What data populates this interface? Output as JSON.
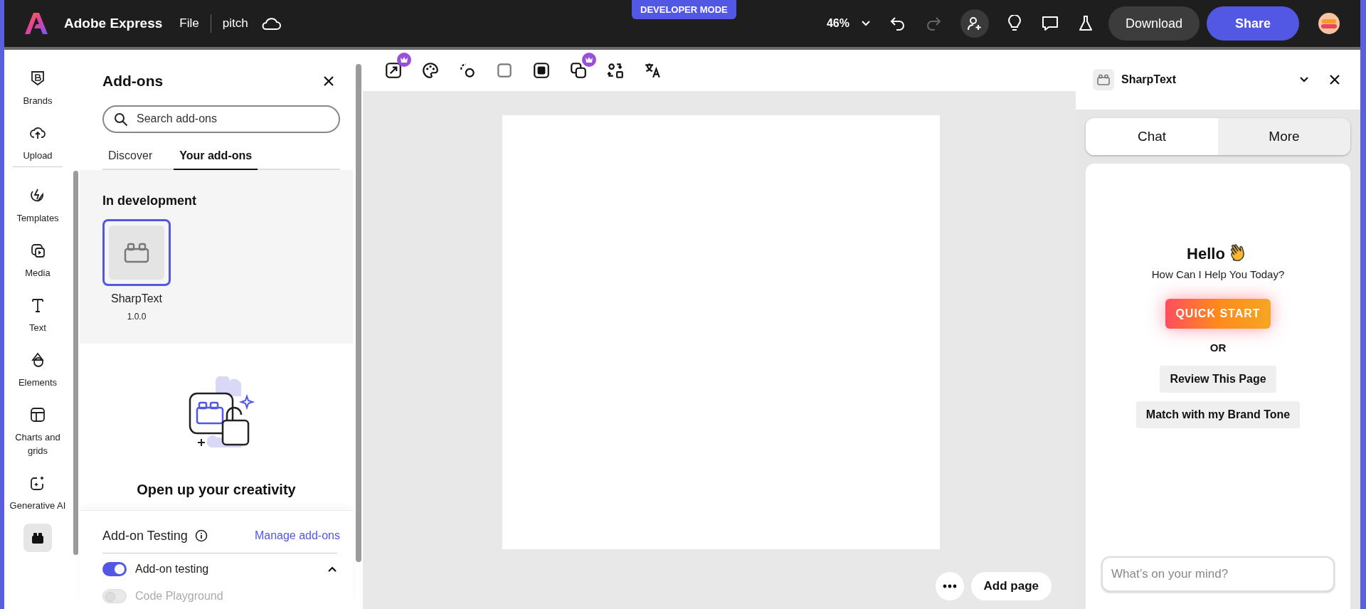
{
  "topbar": {
    "app_name": "Adobe Express",
    "menu": "File",
    "document": "pitch",
    "badge": "DEVELOPER MODE",
    "zoom": "46%",
    "history": [
      {
        "disabled": false
      },
      {
        "disabled": true
      }
    ],
    "download": "Download",
    "share": "Share"
  },
  "rail": {
    "items": [
      {
        "label": "Brands",
        "selected": false
      },
      {
        "label": "Upload",
        "selected": false
      },
      {
        "label": "Templates",
        "selected": false
      },
      {
        "label": "Media",
        "selected": false
      },
      {
        "label": "Text",
        "selected": false
      },
      {
        "label": "Elements",
        "selected": false
      },
      {
        "label": "Charts and grids",
        "selected": false
      },
      {
        "label": "Generative AI",
        "selected": false
      },
      {
        "selected": true
      }
    ]
  },
  "addons_panel": {
    "title": "Add-ons",
    "search": {
      "placeholder": "Search add-ons"
    },
    "tabs": [
      {
        "label": "Discover",
        "selected": false
      },
      {
        "label": "Your add-ons",
        "selected": true
      }
    ],
    "section": "In development",
    "addons": [
      {
        "name": "SharpText",
        "version": "1.0.0",
        "selected": true
      }
    ],
    "empty_state": {
      "title": "Open up your creativity"
    },
    "testing": {
      "title": "Add-on Testing",
      "link": "Manage add-ons",
      "expanded": true,
      "toggles": [
        {
          "label": "Add-on testing",
          "on": true,
          "disabled": false
        },
        {
          "label": "Code Playground",
          "on": false,
          "disabled": true
        }
      ]
    }
  },
  "canvas": {
    "tools": [
      {
        "premium": true
      },
      {
        "premium": false
      },
      {
        "premium": false
      },
      {
        "premium": false
      },
      {
        "premium": false
      },
      {
        "premium": true
      },
      {
        "premium": false
      },
      {
        "premium": false
      }
    ],
    "add_page": "Add page"
  },
  "sharptext_panel": {
    "title": "SharpText",
    "tabs": [
      {
        "label": "Chat",
        "selected": true
      },
      {
        "label": "More",
        "selected": false
      }
    ],
    "greeting": "Hello",
    "subtitle": "How Can I Help You Today?",
    "quick_start": "QUICK START",
    "or": "OR",
    "suggestions": [
      "Review This Page",
      "Match with my Brand Tone"
    ],
    "input": {
      "placeholder": "What’s on your mind?"
    }
  }
}
